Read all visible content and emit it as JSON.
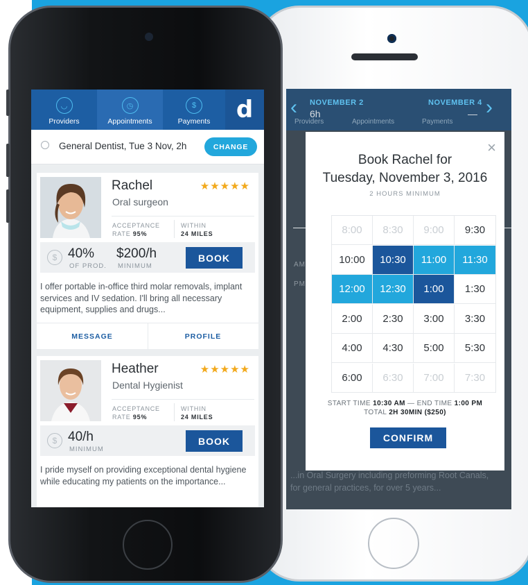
{
  "left_app": {
    "tabs": [
      {
        "label": "Providers",
        "icon": "tooth-icon"
      },
      {
        "label": "Appointments",
        "icon": "clock-icon"
      },
      {
        "label": "Payments",
        "icon": "dollar-icon"
      }
    ],
    "logo_letter": "d",
    "search": {
      "text": "General Dentist, Tue 3 Nov, 2h",
      "change_label": "CHANGE"
    },
    "providers": [
      {
        "name": "Rachel",
        "role": "Oral surgeon",
        "stars": "★★★★★",
        "acceptance_label": "ACCEPTANCE",
        "acceptance_rate_label": "RATE",
        "acceptance_rate": "95%",
        "within_label": "WITHIN",
        "distance": "24 MILES",
        "price_primary": "40%",
        "price_primary_sub": "OF PROD.",
        "price_secondary": "$200/h",
        "price_secondary_sub": "MINIMUM",
        "book_label": "BOOK",
        "description": "I offer portable in-office third molar removals, implant services and IV sedation. I'll bring all necessary equipment, supplies and drugs...",
        "message_label": "MESSAGE",
        "profile_label": "PROFILE"
      },
      {
        "name": "Heather",
        "role": "Dental Hygienist",
        "stars": "★★★★★",
        "acceptance_label": "ACCEPTANCE",
        "acceptance_rate_label": "RATE",
        "acceptance_rate": "95%",
        "within_label": "WITHIN",
        "distance": "24 MILES",
        "price_primary": "40/h",
        "price_primary_sub": "MINIMUM",
        "book_label": "BOOK",
        "description": "I pride myself on providing exceptional dental hygiene while educating my patients on the importance..."
      }
    ]
  },
  "right_app": {
    "background": {
      "date_left": "NOVEMBER 2",
      "sub_left": "6h",
      "date_right": "NOVEMBER 4",
      "sub_right": "—",
      "nav": [
        "Providers",
        "Appointments",
        "Payments"
      ],
      "body_text": "...in Oral Surgery including preforming Root Canals, for general practices, for over 5 years..."
    },
    "modal": {
      "title_line1": "Book Rachel for",
      "title_line2": "Tuesday, November 3, 2016",
      "minimum": "2 HOURS MINIMUM",
      "am_label": "AM",
      "pm_label": "PM",
      "slots": [
        {
          "t": "8:00",
          "s": "past"
        },
        {
          "t": "8:30",
          "s": "past"
        },
        {
          "t": "9:00",
          "s": "past"
        },
        {
          "t": "9:30",
          "s": "open"
        },
        {
          "t": "10:00",
          "s": "open"
        },
        {
          "t": "10:30",
          "s": "start"
        },
        {
          "t": "11:00",
          "s": "range"
        },
        {
          "t": "11:30",
          "s": "range"
        },
        {
          "t": "12:00",
          "s": "range"
        },
        {
          "t": "12:30",
          "s": "range"
        },
        {
          "t": "1:00",
          "s": "end"
        },
        {
          "t": "1:30",
          "s": "open"
        },
        {
          "t": "2:00",
          "s": "open"
        },
        {
          "t": "2:30",
          "s": "open"
        },
        {
          "t": "3:00",
          "s": "open"
        },
        {
          "t": "3:30",
          "s": "open"
        },
        {
          "t": "4:00",
          "s": "open"
        },
        {
          "t": "4:30",
          "s": "open"
        },
        {
          "t": "5:00",
          "s": "open"
        },
        {
          "t": "5:30",
          "s": "open"
        },
        {
          "t": "6:00",
          "s": "open"
        },
        {
          "t": "6:30",
          "s": "past"
        },
        {
          "t": "7:00",
          "s": "past"
        },
        {
          "t": "7:30",
          "s": "past"
        }
      ],
      "start_label": "START TIME",
      "start_time": "10:30 AM",
      "end_label": "END TIME",
      "end_time": "1:00 PM",
      "total_label": "TOTAL",
      "total_value": "2H 30MIN ($250)",
      "confirm_label": "CONFIRM",
      "close_icon": "×"
    }
  },
  "colors": {
    "brand_blue": "#1d5ea3",
    "accent_cyan": "#22a7dc",
    "dark_blue": "#1b569b",
    "star": "#f2a91c"
  }
}
